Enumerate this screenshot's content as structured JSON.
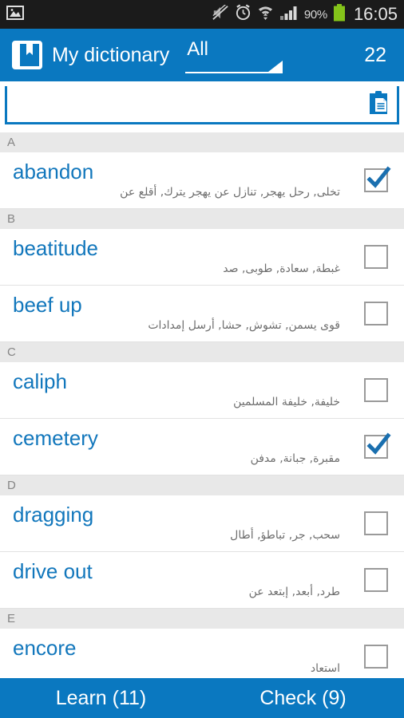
{
  "status_bar": {
    "left_icon": "image-icon",
    "icons": [
      "mute-icon",
      "alarm-icon",
      "wifi-icon",
      "signal-icon"
    ],
    "battery_percent": "90%",
    "battery_icon": "battery-icon",
    "clock": "16:05"
  },
  "action_bar": {
    "app_icon": "book-bookmark-icon",
    "title": "My dictionary",
    "filter_label": "All",
    "filter_caret_icon": "dropdown-triangle-icon",
    "count": "22"
  },
  "search": {
    "value": "",
    "placeholder": "",
    "clipboard_icon": "clipboard-paste-icon"
  },
  "colors": {
    "accent": "#0a78c0",
    "word_blue": "#1277bc",
    "section_bg": "#e8e8e8",
    "section_text": "#858585",
    "translation_text": "#6e6e6e",
    "status_bar_bg": "#1b1b1b"
  },
  "sections": [
    {
      "letter": "A",
      "entries": [
        {
          "term": "abandon",
          "translation": "تخلى, رحل يهجر, تنازل عن يهجر يترك, أقلع عن",
          "checked": true
        }
      ]
    },
    {
      "letter": "B",
      "entries": [
        {
          "term": "beatitude",
          "translation": "غبطة, سعادة, طوبى, صد",
          "checked": false
        },
        {
          "term": "beef up",
          "translation": "قوى يسمن, تشوش, حشا, أرسل إمدادات",
          "checked": false
        }
      ]
    },
    {
      "letter": "C",
      "entries": [
        {
          "term": "caliph",
          "translation": "خليفة, خليفة المسلمين",
          "checked": false
        },
        {
          "term": "cemetery",
          "translation": "مقبرة, جبانة, مدفن",
          "checked": true
        }
      ]
    },
    {
      "letter": "D",
      "entries": [
        {
          "term": "dragging",
          "translation": "سحب, جر, تباطؤ, أطال",
          "checked": false
        },
        {
          "term": "drive out",
          "translation": "طرد, أبعد, إبتعد عن",
          "checked": false
        }
      ]
    },
    {
      "letter": "E",
      "entries": [
        {
          "term": "encore",
          "translation": "استعاد",
          "checked": false
        }
      ]
    }
  ],
  "bottom_bar": {
    "learn_label": "Learn (11)",
    "check_label": "Check (9)"
  }
}
